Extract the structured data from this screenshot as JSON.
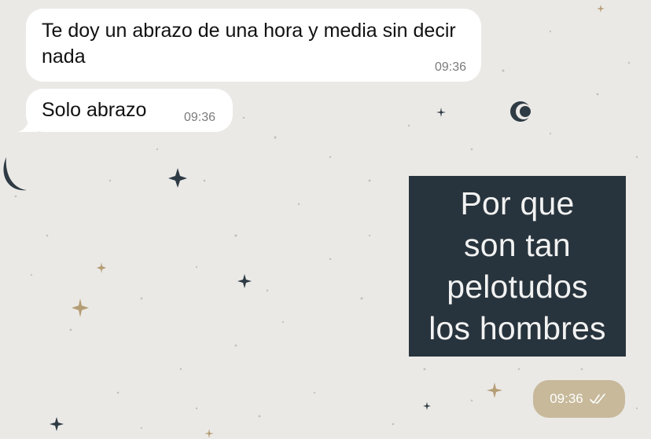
{
  "colors": {
    "wallpaper": "#ebe9e6",
    "incoming_bubble": "#ffffff",
    "sticker_background": "#28343d",
    "sticker_text": "#f2f2f2",
    "sent_timestamp_pill": "#c7b99a"
  },
  "messages": [
    {
      "direction": "incoming",
      "text": "Te doy un abrazo de una hora y media sin decir nada",
      "time": "09:36"
    },
    {
      "direction": "incoming",
      "text": "Solo abrazo",
      "time": "09:36"
    }
  ],
  "sticker": {
    "direction": "outgoing",
    "text": "Por que\nson tan\npelotudos\nlos hombres",
    "time": "09:36",
    "status_icon": "double-check-icon"
  }
}
